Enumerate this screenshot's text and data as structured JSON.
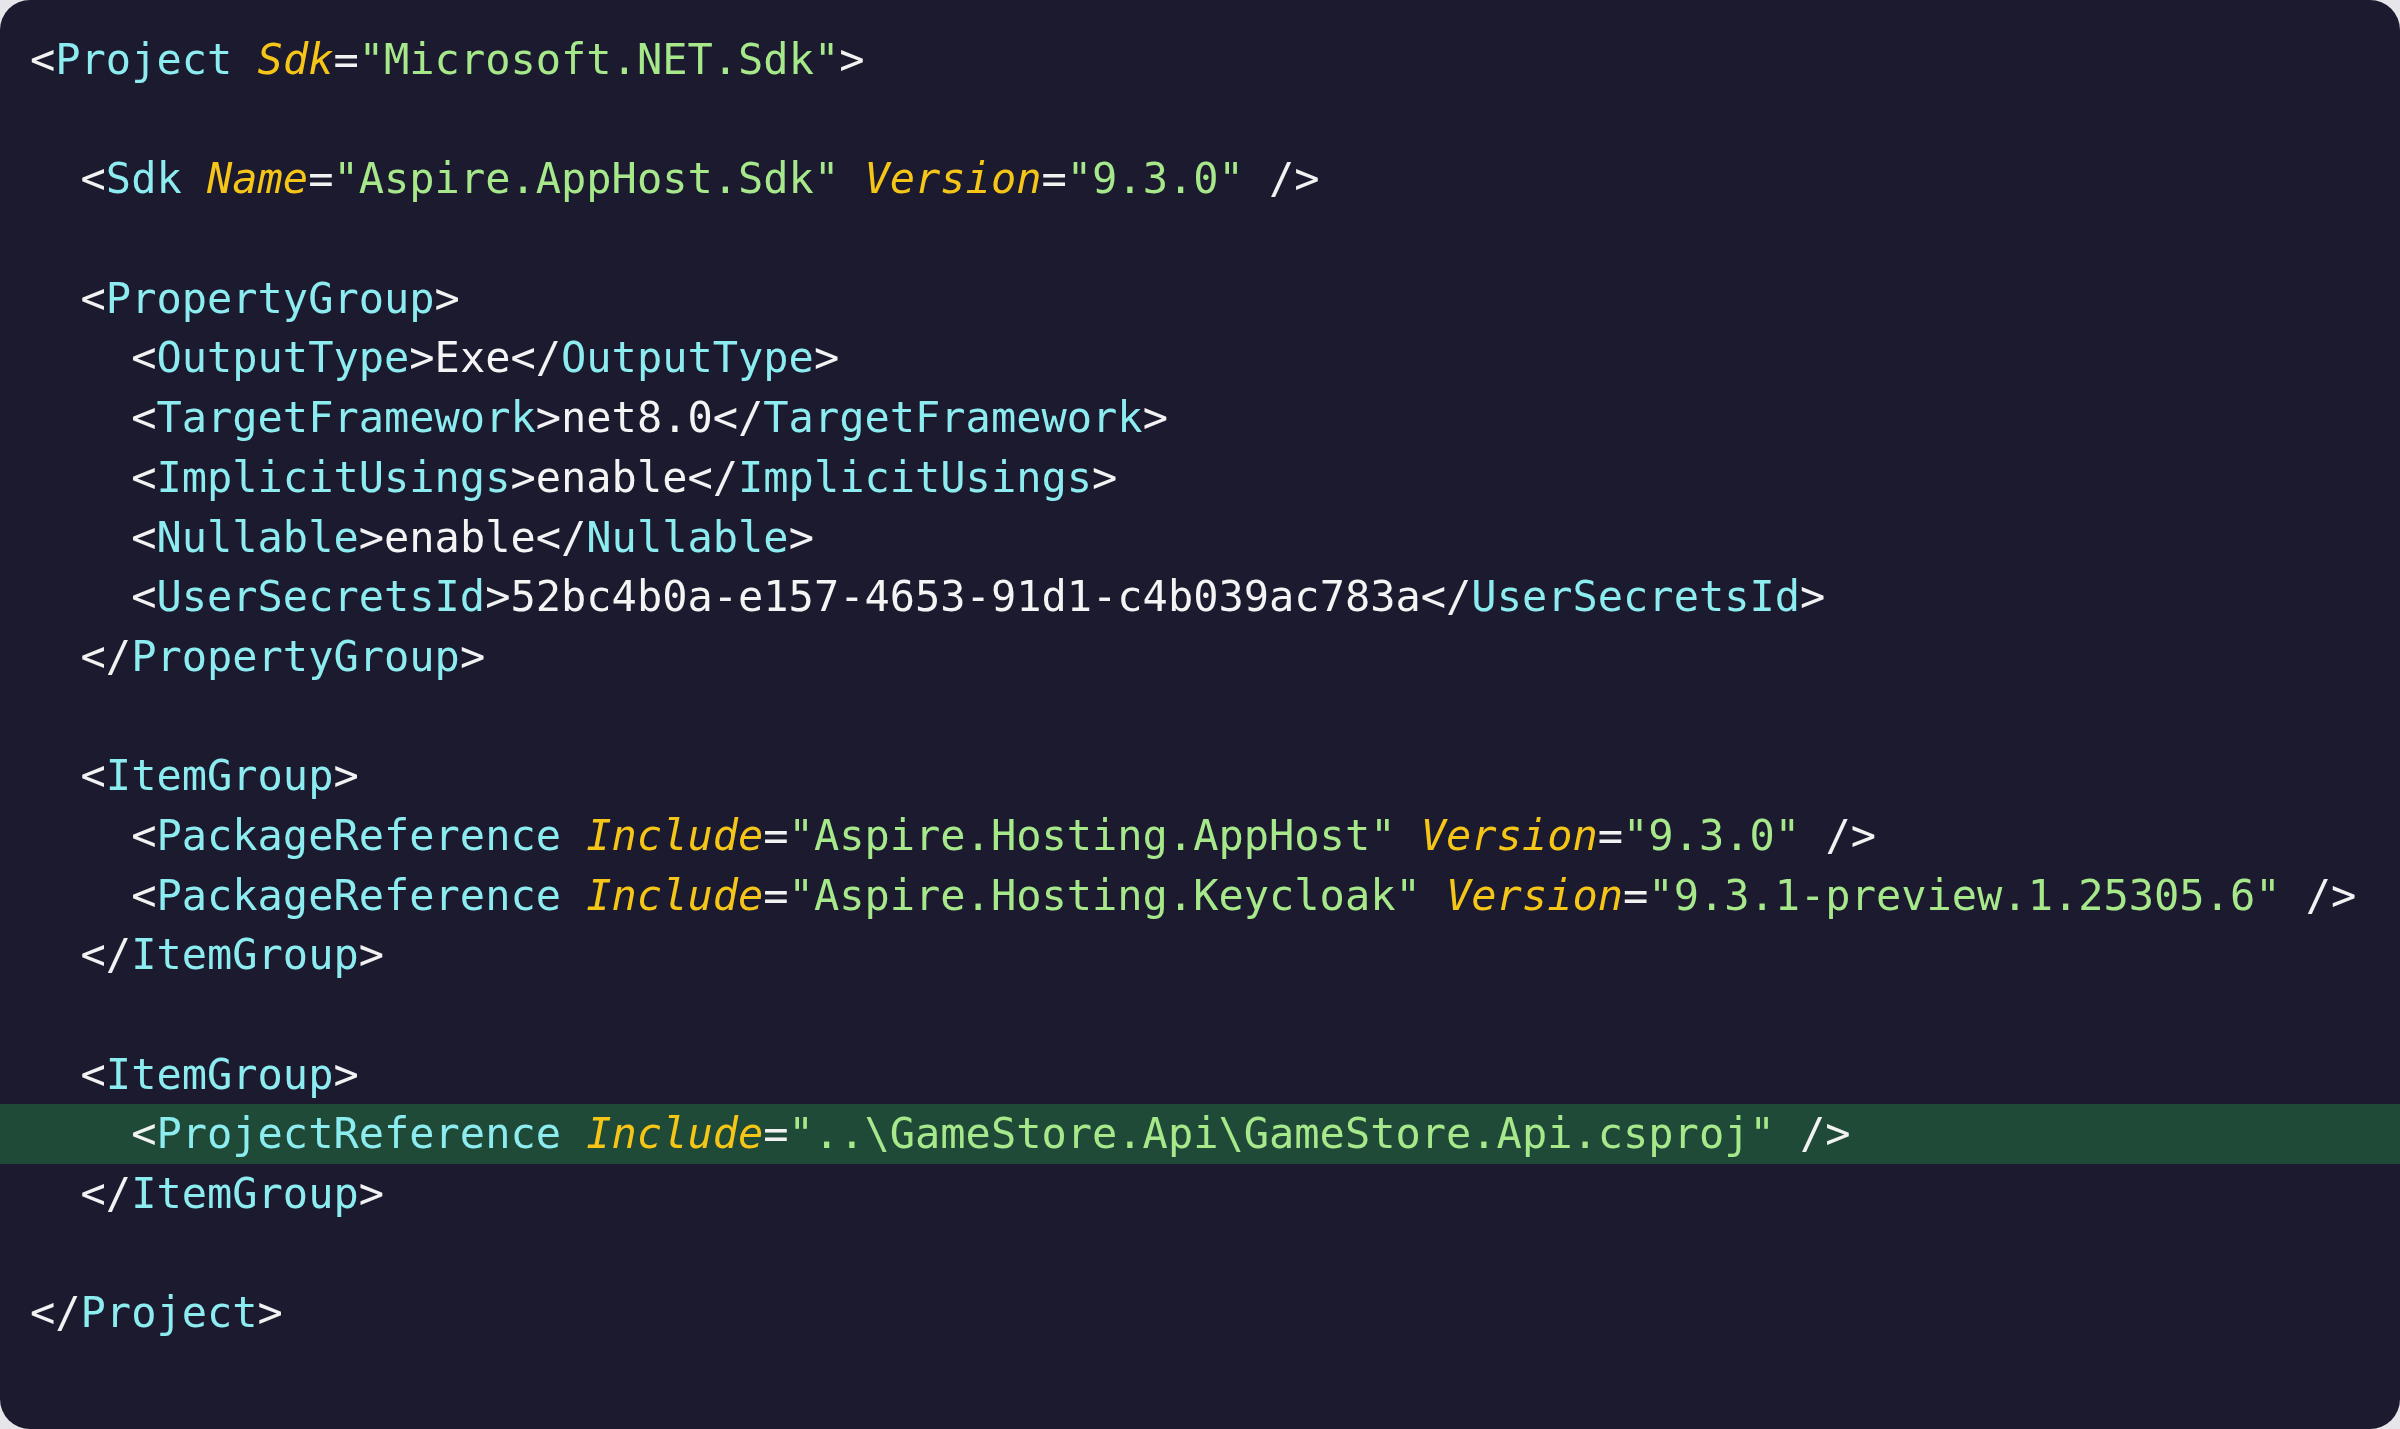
{
  "lines": [
    {
      "highlighted": false,
      "tokens": [
        {
          "kind": "punct",
          "text": "<"
        },
        {
          "kind": "tag",
          "text": "Project"
        },
        {
          "kind": "attr",
          "text": " Sdk"
        },
        {
          "kind": "punct",
          "text": "="
        },
        {
          "kind": "string",
          "text": "\"Microsoft.NET.Sdk\""
        },
        {
          "kind": "punct",
          "text": ">"
        }
      ]
    },
    {
      "highlighted": false
    },
    {
      "highlighted": false,
      "tokens": [
        {
          "kind": "punct",
          "text": "  <"
        },
        {
          "kind": "tag",
          "text": "Sdk"
        },
        {
          "kind": "attr",
          "text": " Name"
        },
        {
          "kind": "punct",
          "text": "="
        },
        {
          "kind": "string",
          "text": "\"Aspire.AppHost.Sdk\""
        },
        {
          "kind": "attr",
          "text": " Version"
        },
        {
          "kind": "punct",
          "text": "="
        },
        {
          "kind": "string",
          "text": "\"9.3.0\""
        },
        {
          "kind": "punct",
          "text": " />"
        }
      ]
    },
    {
      "highlighted": false
    },
    {
      "highlighted": false,
      "tokens": [
        {
          "kind": "punct",
          "text": "  <"
        },
        {
          "kind": "tag",
          "text": "PropertyGroup"
        },
        {
          "kind": "punct",
          "text": ">"
        }
      ]
    },
    {
      "highlighted": false,
      "tokens": [
        {
          "kind": "punct",
          "text": "    <"
        },
        {
          "kind": "tag",
          "text": "OutputType"
        },
        {
          "kind": "punct",
          "text": ">"
        },
        {
          "kind": "text",
          "text": "Exe"
        },
        {
          "kind": "punct",
          "text": "</"
        },
        {
          "kind": "tag",
          "text": "OutputType"
        },
        {
          "kind": "punct",
          "text": ">"
        }
      ]
    },
    {
      "highlighted": false,
      "tokens": [
        {
          "kind": "punct",
          "text": "    <"
        },
        {
          "kind": "tag",
          "text": "TargetFramework"
        },
        {
          "kind": "punct",
          "text": ">"
        },
        {
          "kind": "text",
          "text": "net8.0"
        },
        {
          "kind": "punct",
          "text": "</"
        },
        {
          "kind": "tag",
          "text": "TargetFramework"
        },
        {
          "kind": "punct",
          "text": ">"
        }
      ]
    },
    {
      "highlighted": false,
      "tokens": [
        {
          "kind": "punct",
          "text": "    <"
        },
        {
          "kind": "tag",
          "text": "ImplicitUsings"
        },
        {
          "kind": "punct",
          "text": ">"
        },
        {
          "kind": "text",
          "text": "enable"
        },
        {
          "kind": "punct",
          "text": "</"
        },
        {
          "kind": "tag",
          "text": "ImplicitUsings"
        },
        {
          "kind": "punct",
          "text": ">"
        }
      ]
    },
    {
      "highlighted": false,
      "tokens": [
        {
          "kind": "punct",
          "text": "    <"
        },
        {
          "kind": "tag",
          "text": "Nullable"
        },
        {
          "kind": "punct",
          "text": ">"
        },
        {
          "kind": "text",
          "text": "enable"
        },
        {
          "kind": "punct",
          "text": "</"
        },
        {
          "kind": "tag",
          "text": "Nullable"
        },
        {
          "kind": "punct",
          "text": ">"
        }
      ]
    },
    {
      "highlighted": false,
      "tokens": [
        {
          "kind": "punct",
          "text": "    <"
        },
        {
          "kind": "tag",
          "text": "UserSecretsId"
        },
        {
          "kind": "punct",
          "text": ">"
        },
        {
          "kind": "text",
          "text": "52bc4b0a-e157-4653-91d1-c4b039ac783a"
        },
        {
          "kind": "punct",
          "text": "</"
        },
        {
          "kind": "tag",
          "text": "UserSecretsId"
        },
        {
          "kind": "punct",
          "text": ">"
        }
      ]
    },
    {
      "highlighted": false,
      "tokens": [
        {
          "kind": "punct",
          "text": "  </"
        },
        {
          "kind": "tag",
          "text": "PropertyGroup"
        },
        {
          "kind": "punct",
          "text": ">"
        }
      ]
    },
    {
      "highlighted": false
    },
    {
      "highlighted": false,
      "tokens": [
        {
          "kind": "punct",
          "text": "  <"
        },
        {
          "kind": "tag",
          "text": "ItemGroup"
        },
        {
          "kind": "punct",
          "text": ">"
        }
      ]
    },
    {
      "highlighted": false,
      "tokens": [
        {
          "kind": "punct",
          "text": "    <"
        },
        {
          "kind": "tag",
          "text": "PackageReference"
        },
        {
          "kind": "attr",
          "text": " Include"
        },
        {
          "kind": "punct",
          "text": "="
        },
        {
          "kind": "string",
          "text": "\"Aspire.Hosting.AppHost\""
        },
        {
          "kind": "attr",
          "text": " Version"
        },
        {
          "kind": "punct",
          "text": "="
        },
        {
          "kind": "string",
          "text": "\"9.3.0\""
        },
        {
          "kind": "punct",
          "text": " />"
        }
      ]
    },
    {
      "highlighted": false,
      "tokens": [
        {
          "kind": "punct",
          "text": "    <"
        },
        {
          "kind": "tag",
          "text": "PackageReference"
        },
        {
          "kind": "attr",
          "text": " Include"
        },
        {
          "kind": "punct",
          "text": "="
        },
        {
          "kind": "string",
          "text": "\"Aspire.Hosting.Keycloak\""
        },
        {
          "kind": "attr",
          "text": " Version"
        },
        {
          "kind": "punct",
          "text": "="
        },
        {
          "kind": "string",
          "text": "\"9.3.1-preview.1.25305.6\""
        },
        {
          "kind": "punct",
          "text": " />"
        }
      ]
    },
    {
      "highlighted": false,
      "tokens": [
        {
          "kind": "punct",
          "text": "  </"
        },
        {
          "kind": "tag",
          "text": "ItemGroup"
        },
        {
          "kind": "punct",
          "text": ">"
        }
      ]
    },
    {
      "highlighted": false
    },
    {
      "highlighted": false,
      "tokens": [
        {
          "kind": "punct",
          "text": "  <"
        },
        {
          "kind": "tag",
          "text": "ItemGroup"
        },
        {
          "kind": "punct",
          "text": ">"
        }
      ]
    },
    {
      "highlighted": true,
      "tokens": [
        {
          "kind": "punct",
          "text": "    <"
        },
        {
          "kind": "tag",
          "text": "ProjectReference"
        },
        {
          "kind": "attr",
          "text": " Include"
        },
        {
          "kind": "punct",
          "text": "="
        },
        {
          "kind": "string",
          "text": "\"..\\GameStore.Api\\GameStore.Api.csproj\""
        },
        {
          "kind": "punct",
          "text": " />"
        }
      ]
    },
    {
      "highlighted": false,
      "tokens": [
        {
          "kind": "punct",
          "text": "  </"
        },
        {
          "kind": "tag",
          "text": "ItemGroup"
        },
        {
          "kind": "punct",
          "text": ">"
        }
      ]
    },
    {
      "highlighted": false
    },
    {
      "highlighted": false,
      "tokens": [
        {
          "kind": "punct",
          "text": "</"
        },
        {
          "kind": "tag",
          "text": "Project"
        },
        {
          "kind": "punct",
          "text": ">"
        }
      ]
    }
  ]
}
